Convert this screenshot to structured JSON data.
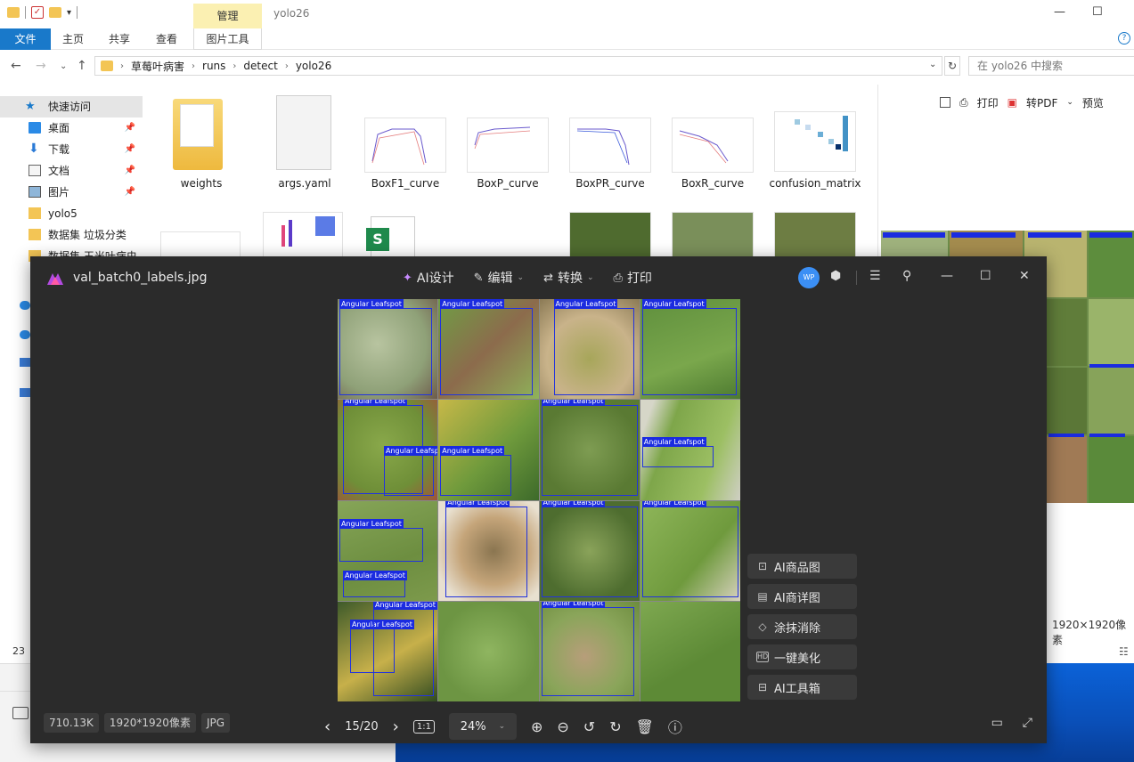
{
  "explorer": {
    "window_title": "yolo26",
    "manage_tab": "管理",
    "ribbon_tabs": [
      "文件",
      "主页",
      "共享",
      "查看",
      "图片工具"
    ],
    "breadcrumb": [
      "草莓叶病害",
      "runs",
      "detect",
      "yolo26"
    ],
    "search_placeholder": "在 yolo26 中搜索",
    "sidebar": [
      {
        "label": "快速访问",
        "icon": "star-icon",
        "pinned": false
      },
      {
        "label": "桌面",
        "icon": "desktop-icon",
        "pinned": true
      },
      {
        "label": "下载",
        "icon": "download-icon",
        "pinned": true
      },
      {
        "label": "文档",
        "icon": "document-icon",
        "pinned": true
      },
      {
        "label": "图片",
        "icon": "picture-icon",
        "pinned": true
      },
      {
        "label": "yolo5",
        "icon": "folder-icon",
        "pinned": false
      },
      {
        "label": "数据集 垃圾分类",
        "icon": "folder-icon",
        "pinned": false
      },
      {
        "label": "数据集 玉米叶病虫",
        "icon": "folder-icon",
        "pinned": false
      }
    ],
    "files": [
      "weights",
      "args.yaml",
      "BoxF1_curve",
      "BoxP_curve",
      "BoxPR_curve",
      "BoxR_curve",
      "confusion_matrix"
    ],
    "preview_toolbar": [
      "打印",
      "转PDF",
      "预览"
    ],
    "preview_dimensions": "1920×1920像素",
    "item_count_partial": "23"
  },
  "viewer": {
    "filename": "val_batch0_labels.jpg",
    "toolbar": [
      "AI设计",
      "编辑",
      "转换",
      "打印"
    ],
    "avatar_text": "WP",
    "side_buttons": [
      {
        "label": "AI商品图",
        "icon": "bag-icon"
      },
      {
        "label": "AI商详图",
        "icon": "detail-icon"
      },
      {
        "label": "涂抹消除",
        "icon": "eraser-icon"
      },
      {
        "label": "一键美化",
        "icon": "hd-icon"
      },
      {
        "label": "AI工具箱",
        "icon": "toolbox-icon"
      }
    ],
    "file_size": "710.13K",
    "resolution": "1920*1920像素",
    "format": "JPG",
    "page_counter": "15/20",
    "zoom": "24%",
    "box_label": "Angular Leafspot",
    "accent": "#1a2be0"
  }
}
